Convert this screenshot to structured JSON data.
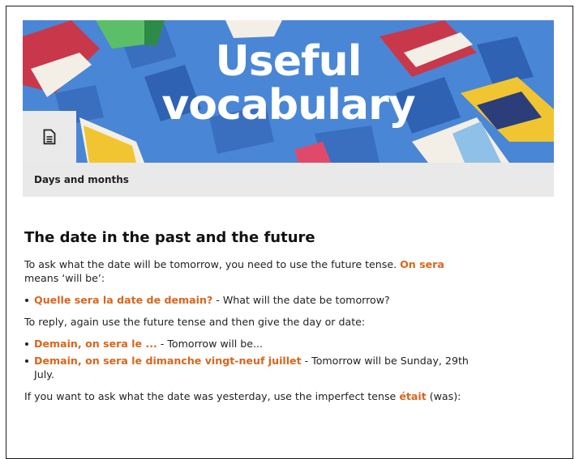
{
  "card": {
    "banner_title_line1": "Useful",
    "banner_title_line2": "vocabulary",
    "doc_icon": "document-icon",
    "label": "Days and months"
  },
  "article": {
    "heading": "The date in the past and the future",
    "p1": {
      "text": "To ask what the date will be tomorrow, you need to use the future tense. ",
      "highlight": "On sera",
      "text2": " means ‘will be’:"
    },
    "list1": [
      {
        "fr": "Quelle sera la date de demain?",
        "en": " - What will the date be tomorrow?"
      }
    ],
    "p2": "To reply, again use the future tense and then give the day or date:",
    "list2": [
      {
        "fr": "Demain, on sera le ...",
        "en": " - Tomorrow will be..."
      },
      {
        "fr": "Demain, on sera le dimanche vingt-neuf juillet",
        "en": " - Tomorrow will be Sunday, 29th July."
      }
    ],
    "p3": {
      "text": "If you want to ask what the date was yesterday, use the imperfect tense ",
      "highlight": "était",
      "text2": " (was):"
    }
  },
  "colors": {
    "banner_bg": "#4a86d6",
    "highlight": "#d9651c",
    "card_bg": "#e9e9e9"
  }
}
